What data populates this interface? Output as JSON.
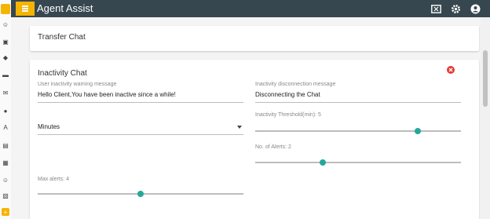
{
  "app": {
    "title": "Agent Assist"
  },
  "cards": {
    "transfer": {
      "title": "Transfer Chat"
    },
    "inactivity": {
      "title": "Inactivity Chat",
      "warning": {
        "label": "User inactivity warning message",
        "value": "Hello Client,You have been inactive since a while!"
      },
      "disconnect": {
        "label": "Inactivity disconnection message",
        "value": "Disconnecting the Chat"
      },
      "unit": {
        "value": "Minutes"
      },
      "threshold": {
        "label": "Inactivity Threshold(min): 5",
        "level": 0.79
      },
      "alerts": {
        "label": "No. of Alerts: 2",
        "level": 0.33
      },
      "max_alerts": {
        "label": "Max alerts: 4",
        "level": 0.5
      }
    }
  },
  "colors": {
    "topbar": "#37474f",
    "accent": "#f5b400",
    "slider": "#26a69a",
    "close": "#e53935"
  }
}
